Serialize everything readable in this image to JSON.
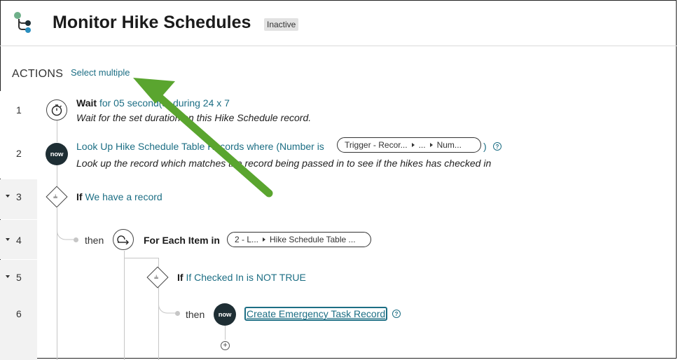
{
  "header": {
    "title": "Monitor Hike Schedules",
    "status": "Inactive"
  },
  "actions": {
    "label": "ACTIONS",
    "select_multiple": "Select multiple"
  },
  "rows": [
    {
      "num": "1"
    },
    {
      "num": "2"
    },
    {
      "num": "3"
    },
    {
      "num": "4"
    },
    {
      "num": "5"
    },
    {
      "num": "6"
    }
  ],
  "steps": {
    "wait": {
      "keyword": "Wait",
      "detail": "for 05 second(s) during 24 x 7",
      "description": "Wait for the set duration on this Hike Schedule record."
    },
    "lookup": {
      "text": "Look Up Hike Schedule Table Records where (Number is",
      "pill": [
        "Trigger - Recor...",
        "...",
        "Num..."
      ],
      "close": ")",
      "description": "Look up the record which matches the record being passed in to see if the hikes has checked in"
    },
    "if1": {
      "keyword": "If",
      "condition": "We have a record"
    },
    "foreach": {
      "then": "then",
      "label": "For Each Item in",
      "pill": [
        "2 - L...",
        "Hike Schedule Table ..."
      ]
    },
    "if2": {
      "keyword": "If",
      "condition": "If Checked In is NOT TRUE"
    },
    "create": {
      "then": "then",
      "label": "Create Emergency Task Record"
    }
  },
  "icons": {
    "now_logo_text": "now",
    "help": "?",
    "plus": "+"
  },
  "colors": {
    "link": "#1c6e84",
    "annotation_arrow": "#5aa52f",
    "app_icon_green": "#6fb08a",
    "app_icon_blue": "#2b8fbf"
  }
}
